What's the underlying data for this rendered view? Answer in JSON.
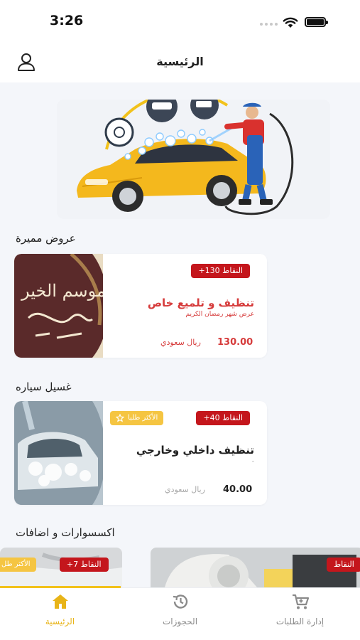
{
  "status_bar": {
    "time": "3:26"
  },
  "header": {
    "title": "الرئيسية"
  },
  "sections": {
    "featured_title": "عروض مميرة",
    "car_wash_title": "غسيل سياره",
    "accessories_title": "اكسسوارات و اضافات"
  },
  "offers": [
    {
      "points": "+130 النقاط",
      "name": "تنظيف و تلميع خاص",
      "subtitle": "عرض شهر رمضان الكريم",
      "price": "130.00",
      "currency": "ريال سعودي",
      "image_text": "في موسم الخير"
    }
  ],
  "car_wash": [
    {
      "points": "+40 النقاط",
      "popular": "الأكثر طلبا",
      "name": "تنظيف داخلي وخارجي",
      "subtitle": "-",
      "price": "40.00",
      "currency": "ريال سعودي"
    }
  ],
  "accessories": [
    {
      "points": "+7 النقاط",
      "popular": "الأكثر طل"
    },
    {
      "points": "النقاط"
    }
  ],
  "tabs": [
    {
      "label": "الرئيسية",
      "icon": "home-icon",
      "active": true
    },
    {
      "label": "الحجوزات",
      "icon": "history-icon",
      "active": false
    },
    {
      "label": "إدارة الطلبات",
      "icon": "cart-icon",
      "active": false
    }
  ],
  "colors": {
    "accent": "#f2c21b",
    "points_badge": "#c4161c",
    "popular_badge": "#f5c542",
    "price_red": "#d63b3b"
  }
}
